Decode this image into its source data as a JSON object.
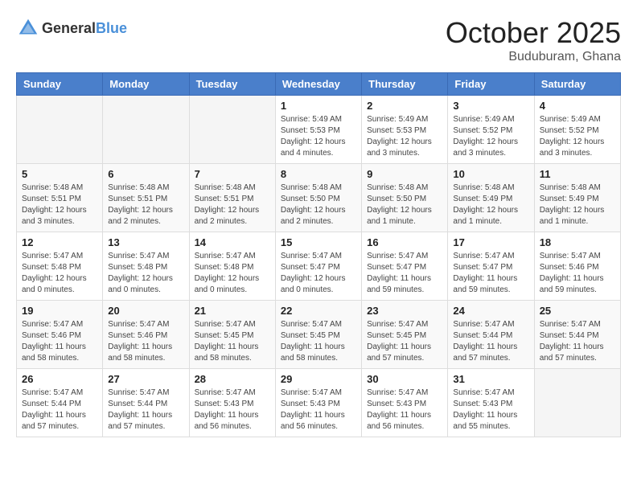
{
  "header": {
    "logo_general": "General",
    "logo_blue": "Blue",
    "month": "October 2025",
    "location": "Buduburam, Ghana"
  },
  "weekdays": [
    "Sunday",
    "Monday",
    "Tuesday",
    "Wednesday",
    "Thursday",
    "Friday",
    "Saturday"
  ],
  "weeks": [
    [
      {
        "day": "",
        "info": ""
      },
      {
        "day": "",
        "info": ""
      },
      {
        "day": "",
        "info": ""
      },
      {
        "day": "1",
        "info": "Sunrise: 5:49 AM\nSunset: 5:53 PM\nDaylight: 12 hours\nand 4 minutes."
      },
      {
        "day": "2",
        "info": "Sunrise: 5:49 AM\nSunset: 5:53 PM\nDaylight: 12 hours\nand 3 minutes."
      },
      {
        "day": "3",
        "info": "Sunrise: 5:49 AM\nSunset: 5:52 PM\nDaylight: 12 hours\nand 3 minutes."
      },
      {
        "day": "4",
        "info": "Sunrise: 5:49 AM\nSunset: 5:52 PM\nDaylight: 12 hours\nand 3 minutes."
      }
    ],
    [
      {
        "day": "5",
        "info": "Sunrise: 5:48 AM\nSunset: 5:51 PM\nDaylight: 12 hours\nand 3 minutes."
      },
      {
        "day": "6",
        "info": "Sunrise: 5:48 AM\nSunset: 5:51 PM\nDaylight: 12 hours\nand 2 minutes."
      },
      {
        "day": "7",
        "info": "Sunrise: 5:48 AM\nSunset: 5:51 PM\nDaylight: 12 hours\nand 2 minutes."
      },
      {
        "day": "8",
        "info": "Sunrise: 5:48 AM\nSunset: 5:50 PM\nDaylight: 12 hours\nand 2 minutes."
      },
      {
        "day": "9",
        "info": "Sunrise: 5:48 AM\nSunset: 5:50 PM\nDaylight: 12 hours\nand 1 minute."
      },
      {
        "day": "10",
        "info": "Sunrise: 5:48 AM\nSunset: 5:49 PM\nDaylight: 12 hours\nand 1 minute."
      },
      {
        "day": "11",
        "info": "Sunrise: 5:48 AM\nSunset: 5:49 PM\nDaylight: 12 hours\nand 1 minute."
      }
    ],
    [
      {
        "day": "12",
        "info": "Sunrise: 5:47 AM\nSunset: 5:48 PM\nDaylight: 12 hours\nand 0 minutes."
      },
      {
        "day": "13",
        "info": "Sunrise: 5:47 AM\nSunset: 5:48 PM\nDaylight: 12 hours\nand 0 minutes."
      },
      {
        "day": "14",
        "info": "Sunrise: 5:47 AM\nSunset: 5:48 PM\nDaylight: 12 hours\nand 0 minutes."
      },
      {
        "day": "15",
        "info": "Sunrise: 5:47 AM\nSunset: 5:47 PM\nDaylight: 12 hours\nand 0 minutes."
      },
      {
        "day": "16",
        "info": "Sunrise: 5:47 AM\nSunset: 5:47 PM\nDaylight: 11 hours\nand 59 minutes."
      },
      {
        "day": "17",
        "info": "Sunrise: 5:47 AM\nSunset: 5:47 PM\nDaylight: 11 hours\nand 59 minutes."
      },
      {
        "day": "18",
        "info": "Sunrise: 5:47 AM\nSunset: 5:46 PM\nDaylight: 11 hours\nand 59 minutes."
      }
    ],
    [
      {
        "day": "19",
        "info": "Sunrise: 5:47 AM\nSunset: 5:46 PM\nDaylight: 11 hours\nand 58 minutes."
      },
      {
        "day": "20",
        "info": "Sunrise: 5:47 AM\nSunset: 5:46 PM\nDaylight: 11 hours\nand 58 minutes."
      },
      {
        "day": "21",
        "info": "Sunrise: 5:47 AM\nSunset: 5:45 PM\nDaylight: 11 hours\nand 58 minutes."
      },
      {
        "day": "22",
        "info": "Sunrise: 5:47 AM\nSunset: 5:45 PM\nDaylight: 11 hours\nand 58 minutes."
      },
      {
        "day": "23",
        "info": "Sunrise: 5:47 AM\nSunset: 5:45 PM\nDaylight: 11 hours\nand 57 minutes."
      },
      {
        "day": "24",
        "info": "Sunrise: 5:47 AM\nSunset: 5:44 PM\nDaylight: 11 hours\nand 57 minutes."
      },
      {
        "day": "25",
        "info": "Sunrise: 5:47 AM\nSunset: 5:44 PM\nDaylight: 11 hours\nand 57 minutes."
      }
    ],
    [
      {
        "day": "26",
        "info": "Sunrise: 5:47 AM\nSunset: 5:44 PM\nDaylight: 11 hours\nand 57 minutes."
      },
      {
        "day": "27",
        "info": "Sunrise: 5:47 AM\nSunset: 5:44 PM\nDaylight: 11 hours\nand 57 minutes."
      },
      {
        "day": "28",
        "info": "Sunrise: 5:47 AM\nSunset: 5:43 PM\nDaylight: 11 hours\nand 56 minutes."
      },
      {
        "day": "29",
        "info": "Sunrise: 5:47 AM\nSunset: 5:43 PM\nDaylight: 11 hours\nand 56 minutes."
      },
      {
        "day": "30",
        "info": "Sunrise: 5:47 AM\nSunset: 5:43 PM\nDaylight: 11 hours\nand 56 minutes."
      },
      {
        "day": "31",
        "info": "Sunrise: 5:47 AM\nSunset: 5:43 PM\nDaylight: 11 hours\nand 55 minutes."
      },
      {
        "day": "",
        "info": ""
      }
    ]
  ]
}
